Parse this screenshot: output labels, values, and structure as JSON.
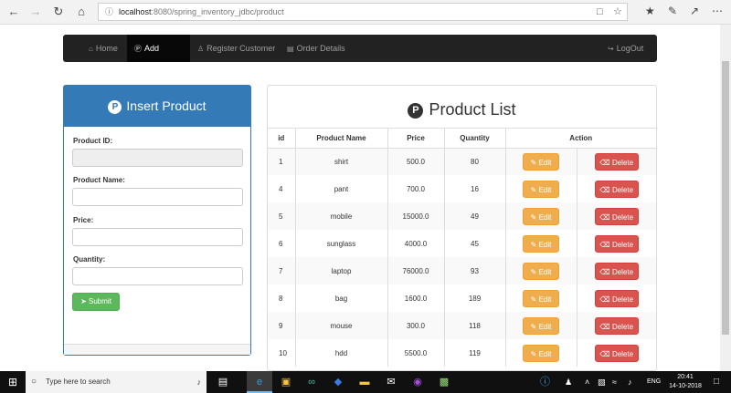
{
  "browser": {
    "url_host": "localhost",
    "url_path": ":8080/spring_inventory_jdbc/product"
  },
  "navbar": {
    "items": [
      {
        "label": "Home",
        "icon": "home-icon"
      },
      {
        "label": "Add Product",
        "icon": "product-hunt-icon",
        "active": true
      },
      {
        "label": "Register Customer",
        "icon": "user-plus-icon"
      },
      {
        "label": "Order Details",
        "icon": "area-chart-icon"
      }
    ],
    "logout": "LogOut"
  },
  "insert_panel": {
    "title": "Insert Product",
    "fields": [
      {
        "label": "Product ID:",
        "value": "",
        "disabled": true
      },
      {
        "label": "Product Name:",
        "value": ""
      },
      {
        "label": "Price:",
        "value": ""
      },
      {
        "label": "Quantity:",
        "value": ""
      }
    ],
    "submit_label": "Submit"
  },
  "product_list": {
    "title": "Product List",
    "columns": [
      "id",
      "Product Name",
      "Price",
      "Quantity",
      "Action"
    ],
    "edit_label": "Edit",
    "delete_label": "Delete",
    "rows": [
      {
        "id": "1",
        "name": "shirt",
        "price": "500.0",
        "quantity": "80"
      },
      {
        "id": "4",
        "name": "pant",
        "price": "700.0",
        "quantity": "16"
      },
      {
        "id": "5",
        "name": "mobile",
        "price": "15000.0",
        "quantity": "49"
      },
      {
        "id": "6",
        "name": "sunglass",
        "price": "4000.0",
        "quantity": "45"
      },
      {
        "id": "7",
        "name": "laptop",
        "price": "76000.0",
        "quantity": "93"
      },
      {
        "id": "8",
        "name": "bag",
        "price": "1600.0",
        "quantity": "189"
      },
      {
        "id": "9",
        "name": "mouse",
        "price": "300.0",
        "quantity": "118"
      },
      {
        "id": "10",
        "name": "hdd",
        "price": "5500.0",
        "quantity": "119"
      }
    ]
  },
  "taskbar": {
    "search_placeholder": "Type here to search",
    "lang": "ENG",
    "time": "20:41",
    "date": "14-10-2018"
  },
  "colors": {
    "primary": "#337ab7",
    "success": "#5cb85c",
    "warning": "#f0ad4e",
    "danger": "#d9534f",
    "navbar": "#222222"
  }
}
